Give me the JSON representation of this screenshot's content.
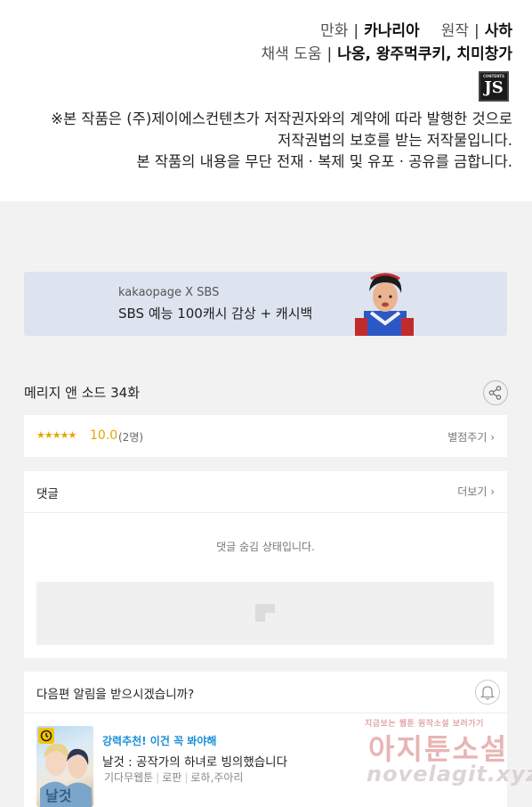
{
  "credits": {
    "comic_label": "만화",
    "comic_value": "카나리아",
    "original_label": "원작",
    "original_value": "사하",
    "color_help_label": "채색 도움",
    "color_help_value": "나옹, 왕주먹쿠키, 치미창가",
    "logo_text": "JS",
    "logo_small": "CONTENTS",
    "notice_lines": [
      "※본 작품은 (주)제이에스컨텐츠가 저작권자와의 계약에 따라 발행한 것으로",
      "저작권법의 보호를 받는 저작물입니다.",
      "본 작품의 내용을 무단 전재 · 복제 및 유포 · 공유를 금합니다."
    ]
  },
  "banner": {
    "brand": "kakaopage X SBS",
    "promo": "SBS 예능 100캐시 감상 + 캐시백"
  },
  "episode": {
    "title": "메리지 앤 소드 34화",
    "share_icon": "share-icon"
  },
  "rating": {
    "stars": "★★★★★",
    "score": "10.0",
    "count": "(2명)",
    "rate_link": "별점주기 ›"
  },
  "comments": {
    "header": "댓글",
    "more_link": "더보기 ›",
    "hidden_message": "댓글 숨김 상태입니다."
  },
  "notify": {
    "question": "다음편 알림을 받으시겠습니까?",
    "bell_icon": "bell-icon"
  },
  "recommendation": {
    "badge": "강력추천! 이건 꼭 봐야해",
    "title": "날것 : 공작가의 하녀로 빙의했습니다",
    "tags": [
      "기다무웹툰",
      "로판",
      "로하,주아리"
    ]
  },
  "watermark": {
    "top": "지금보는 웹툰 원작소설 보러가기",
    "middle": "아지툰소설",
    "bottom": "novelagit.xyz"
  },
  "colors": {
    "accent_star": "#e6a400",
    "accent_link": "#1a8fd8",
    "banner_bg": "#dde4ef"
  }
}
